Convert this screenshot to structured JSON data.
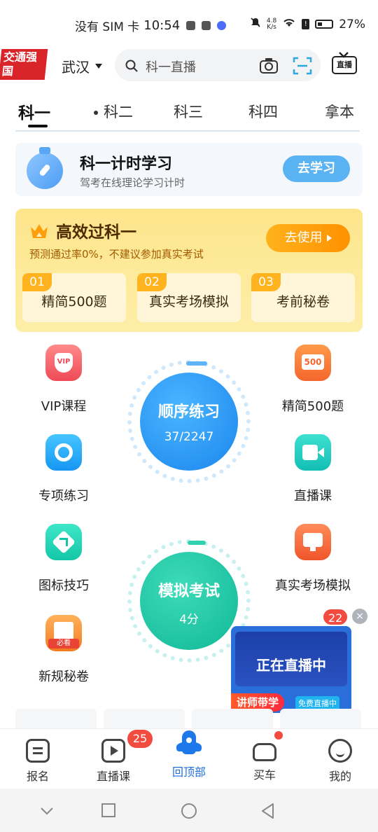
{
  "status_bar": {
    "carrier": "没有 SIM 卡",
    "time": "10:54",
    "net_speed_top": "4.8",
    "net_speed_bottom": "K/s",
    "battery": "27%"
  },
  "header": {
    "promo_logo": "交通强国",
    "city": "武汉",
    "search_placeholder": "科一直播",
    "tv_label": "直播"
  },
  "subject_tabs": [
    "科一",
    "科二",
    "科三",
    "科四",
    "拿本"
  ],
  "timer_card": {
    "title": "科一计时学习",
    "subtitle": "驾考在线理论学习计时",
    "button": "去学习"
  },
  "pass_card": {
    "title": "高效过科一",
    "subtitle": "预测通过率0%，不建议参加真实考试",
    "button": "去使用",
    "items": [
      {
        "num": "01",
        "label": "精简500题"
      },
      {
        "num": "02",
        "label": "真实考场模拟"
      },
      {
        "num": "03",
        "label": "考前秘卷"
      }
    ]
  },
  "features": {
    "vip": "VIP课程",
    "e500": "精简500题",
    "special": "专项练习",
    "live": "直播课",
    "sign": "图标技巧",
    "real": "真实考场模拟",
    "newrule": "新规秘卷",
    "e500_tag": "500",
    "vip_tag": "VIP",
    "newrule_stamp": "必看"
  },
  "practice": {
    "sequence_title": "顺序练习",
    "sequence_progress": "37/2247",
    "mock_title": "模拟考试",
    "mock_score": "4分"
  },
  "live_float": {
    "now_live": "正在直播中",
    "teach": "讲师带学",
    "free": "免费直播中",
    "badge": "22",
    "close": "×"
  },
  "bottom_nav": {
    "items": [
      "报名",
      "直播课",
      "回顶部",
      "买车",
      "我的"
    ],
    "live_badge": "25"
  },
  "colors": {
    "accent_blue": "#1f6fe0",
    "sequence_blue": "#1b86ee",
    "mock_green": "#11b897",
    "promo_yellow": "#fde58b",
    "badge_red": "#f24b3f"
  }
}
